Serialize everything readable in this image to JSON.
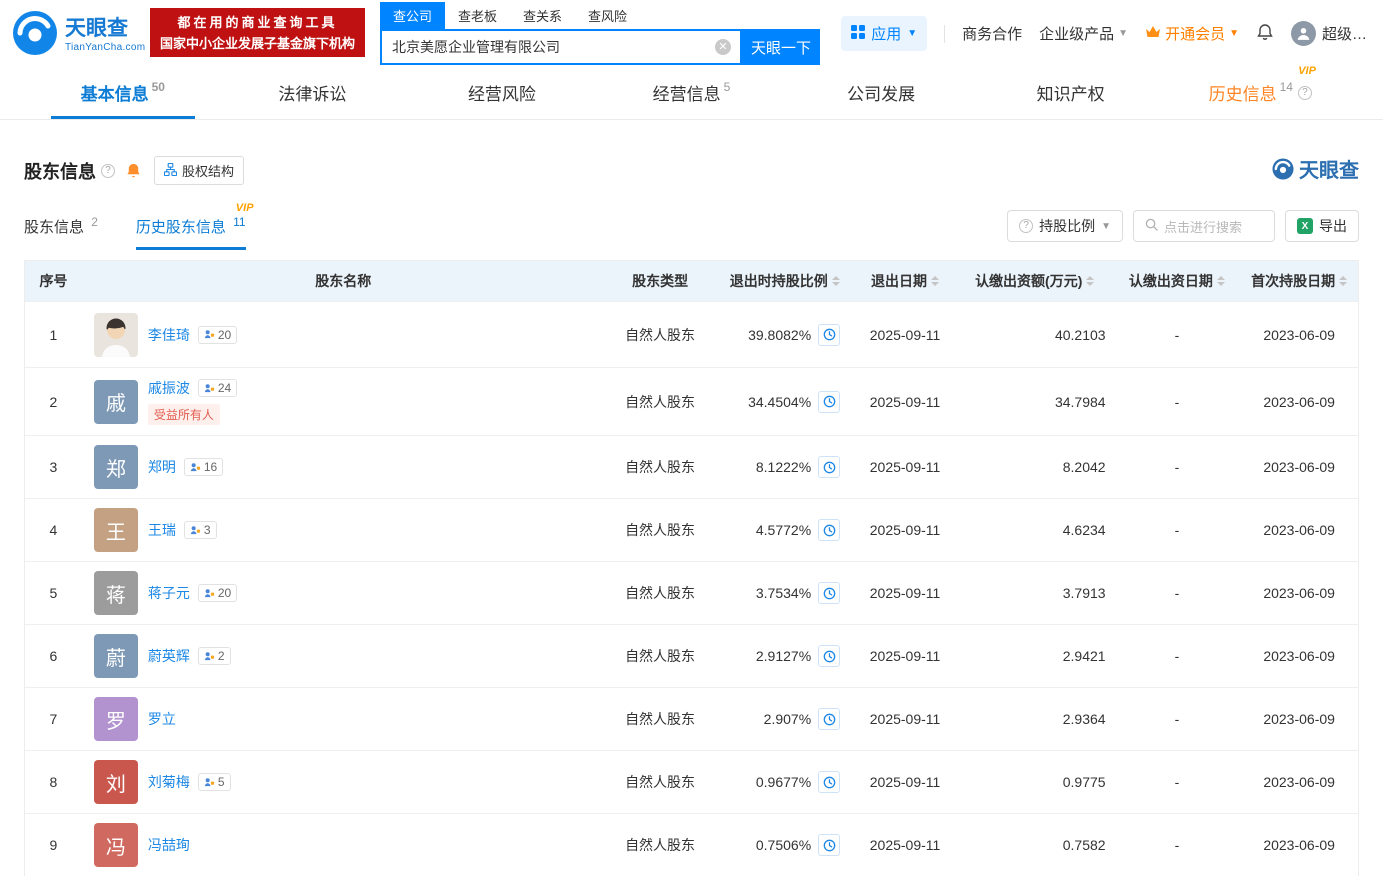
{
  "header": {
    "logo": {
      "title": "天眼查",
      "subtitle": "TianYanCha.com"
    },
    "banner": {
      "line1": "都在用的商业查询工具",
      "line2": "国家中小企业发展子基金旗下机构"
    },
    "search_tabs": [
      {
        "label": "查公司"
      },
      {
        "label": "查老板"
      },
      {
        "label": "查关系"
      },
      {
        "label": "查风险"
      }
    ],
    "search": {
      "value": "北京美愿企业管理有限公司",
      "button": "天眼一下"
    },
    "right": {
      "app": "应用",
      "coop": "商务合作",
      "enterprise": "企业级产品",
      "vip": "开通会员",
      "user": "超级…"
    }
  },
  "nav": {
    "tabs": [
      {
        "label": "基本信息",
        "count": "50"
      },
      {
        "label": "法律诉讼"
      },
      {
        "label": "经营风险"
      },
      {
        "label": "经营信息",
        "count": "5"
      },
      {
        "label": "公司发展"
      },
      {
        "label": "知识产权"
      },
      {
        "label": "历史信息",
        "count": "14",
        "vip": "VIP"
      }
    ]
  },
  "section": {
    "title": "股东信息",
    "equity_structure": "股权结构",
    "watermark": "天眼查",
    "subtabs": [
      {
        "label": "股东信息",
        "count": "2"
      },
      {
        "label": "历史股东信息",
        "count": "11",
        "vip": "VIP"
      }
    ],
    "toolbar": {
      "ratio": "持股比例",
      "search_placeholder": "点击进行搜索",
      "export": "导出"
    }
  },
  "colors": {
    "brand_blue": "#0084ff",
    "active_blue": "#0c7cd5",
    "history_orange": "#ff8524",
    "banner_red": "#bf1111",
    "header_bg": "#ebf3fb"
  },
  "table": {
    "headers": [
      "序号",
      "股东名称",
      "股东类型",
      "退出时持股比例",
      "退出日期",
      "认缴出资额(万元)",
      "认缴出资日期",
      "首次持股日期"
    ],
    "rows": [
      {
        "no": "1",
        "name": "李佳琦",
        "badge": "20",
        "type": "自然人股东",
        "ratio": "39.8082%",
        "exit_date": "2025-09-11",
        "amount": "40.2103",
        "paid_date": "-",
        "first_date": "2023-06-09"
      },
      {
        "no": "2",
        "name": "戚振波",
        "badge": "24",
        "tag": "受益所有人",
        "avatar": "戚",
        "avatar_color": "#7e99b6",
        "type": "自然人股东",
        "ratio": "34.4504%",
        "exit_date": "2025-09-11",
        "amount": "34.7984",
        "paid_date": "-",
        "first_date": "2023-06-09"
      },
      {
        "no": "3",
        "name": "郑明",
        "badge": "16",
        "avatar": "郑",
        "avatar_color": "#7e99b6",
        "type": "自然人股东",
        "ratio": "8.1222%",
        "exit_date": "2025-09-11",
        "amount": "8.2042",
        "paid_date": "-",
        "first_date": "2023-06-09"
      },
      {
        "no": "4",
        "name": "王瑞",
        "badge": "3",
        "avatar": "王",
        "avatar_color": "#c4a183",
        "type": "自然人股东",
        "ratio": "4.5772%",
        "exit_date": "2025-09-11",
        "amount": "4.6234",
        "paid_date": "-",
        "first_date": "2023-06-09"
      },
      {
        "no": "5",
        "name": "蒋子元",
        "badge": "20",
        "avatar": "蒋",
        "avatar_color": "#9c9c9c",
        "type": "自然人股东",
        "ratio": "3.7534%",
        "exit_date": "2025-09-11",
        "amount": "3.7913",
        "paid_date": "-",
        "first_date": "2023-06-09"
      },
      {
        "no": "6",
        "name": "蔚英辉",
        "badge": "2",
        "avatar": "蔚",
        "avatar_color": "#7e99b6",
        "type": "自然人股东",
        "ratio": "2.9127%",
        "exit_date": "2025-09-11",
        "amount": "2.9421",
        "paid_date": "-",
        "first_date": "2023-06-09"
      },
      {
        "no": "7",
        "name": "罗立",
        "avatar": "罗",
        "avatar_color": "#b292cf",
        "type": "自然人股东",
        "ratio": "2.907%",
        "exit_date": "2025-09-11",
        "amount": "2.9364",
        "paid_date": "-",
        "first_date": "2023-06-09"
      },
      {
        "no": "8",
        "name": "刘菊梅",
        "badge": "5",
        "avatar": "刘",
        "avatar_color": "#ca574d",
        "type": "自然人股东",
        "ratio": "0.9677%",
        "exit_date": "2025-09-11",
        "amount": "0.9775",
        "paid_date": "-",
        "first_date": "2023-06-09"
      },
      {
        "no": "9",
        "name": "冯喆珣",
        "avatar": "冯",
        "avatar_color": "#d06a60",
        "type": "自然人股东",
        "ratio": "0.7506%",
        "exit_date": "2025-09-11",
        "amount": "0.7582",
        "paid_date": "-",
        "first_date": "2023-06-09"
      }
    ]
  }
}
